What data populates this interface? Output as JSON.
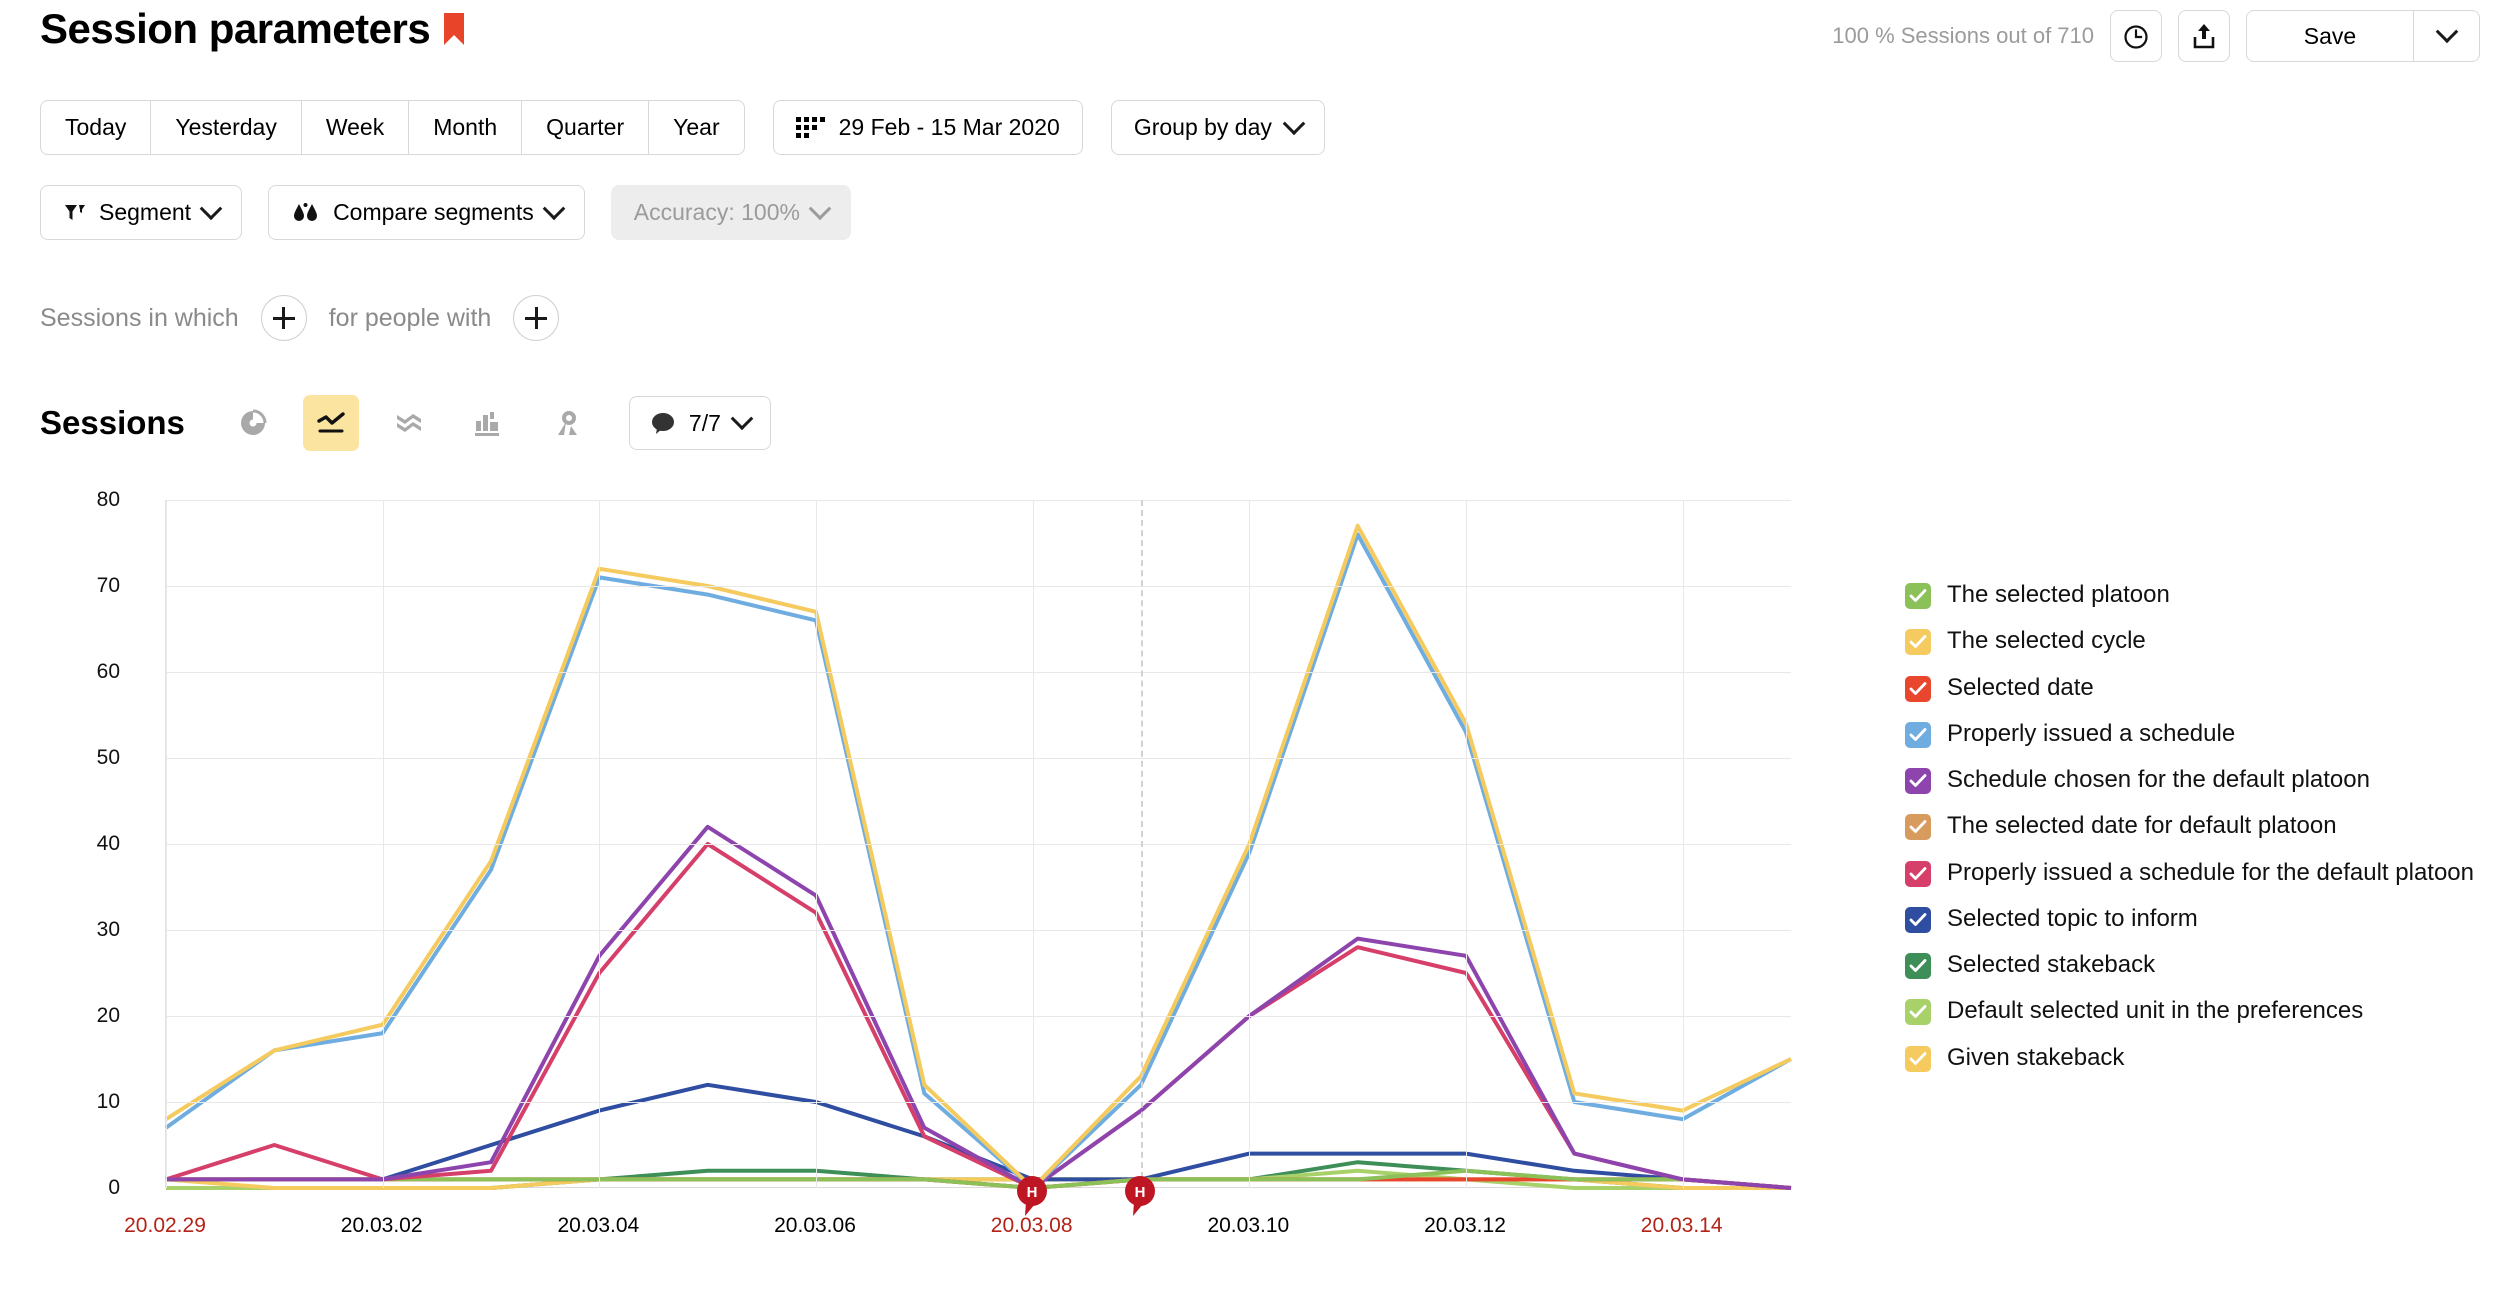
{
  "header": {
    "title": "Session parameters",
    "bookmark_icon": "bookmark-flag-icon",
    "bookmark_color": "#E8442A",
    "sessions_summary": "100 % Sessions out of 710",
    "history_icon": "clock-icon",
    "export_icon": "export-upload-icon",
    "save_label": "Save",
    "save_caret_icon": "chevron-down-icon"
  },
  "toolbar": {
    "periods": [
      "Today",
      "Yesterday",
      "Week",
      "Month",
      "Quarter",
      "Year"
    ],
    "date_range": "29 Feb - 15 Mar 2020",
    "calendar_icon": "calendar-grid-icon",
    "group_by": "Group by day",
    "segment_label": "Segment",
    "segment_icon": "funnel-icon",
    "compare_label": "Compare segments",
    "compare_icon": "two-drops-icon",
    "accuracy_label": "Accuracy: 100%",
    "accuracy_disabled": true
  },
  "filters": {
    "sessions_label": "Sessions in which",
    "people_label": "for people with",
    "add_icon": "plus-icon"
  },
  "chart_header": {
    "metric": "Sessions",
    "viz_buttons": [
      {
        "name": "pie-chart-icon",
        "active": false
      },
      {
        "name": "line-chart-icon",
        "active": true
      },
      {
        "name": "area-chart-icon",
        "active": false
      },
      {
        "name": "bar-chart-icon",
        "active": false
      },
      {
        "name": "map-pin-icon",
        "active": false
      }
    ],
    "annotations_count": "7/7",
    "annotations_icon": "speech-bubble-icon",
    "annotations_caret": "chevron-down-icon"
  },
  "chart_data": {
    "type": "line",
    "title": "Sessions",
    "xlabel": "",
    "ylabel": "",
    "ylim": [
      0,
      80
    ],
    "yticks": [
      0,
      10,
      20,
      30,
      40,
      50,
      60,
      70,
      80
    ],
    "grid": true,
    "legend_position": "right",
    "x": [
      "20.02.29",
      "20.03.01",
      "20.03.02",
      "20.03.03",
      "20.03.04",
      "20.03.05",
      "20.03.06",
      "20.03.07",
      "20.03.08",
      "20.03.09",
      "20.03.10",
      "20.03.11",
      "20.03.12",
      "20.03.13",
      "20.03.14",
      "20.03.15"
    ],
    "xtick_labels": [
      "20.02.29",
      "20.03.02",
      "20.03.04",
      "20.03.06",
      "20.03.08",
      "20.03.10",
      "20.03.12",
      "20.03.14"
    ],
    "weekend_xticks": [
      "20.02.29",
      "20.03.08",
      "20.03.14"
    ],
    "holiday_markers": [
      {
        "x": "20.03.08",
        "label": "H"
      },
      {
        "x": "20.03.09",
        "label": "H"
      }
    ],
    "series": [
      {
        "name": "The selected platoon",
        "color": "#8CC059",
        "values": [
          1,
          1,
          1,
          1,
          1,
          1,
          1,
          1,
          0,
          1,
          1,
          1,
          2,
          1,
          1,
          0
        ]
      },
      {
        "name": "The selected cycle",
        "color": "#F5CA5E",
        "values": [
          8,
          16,
          19,
          38,
          72,
          70,
          67,
          12,
          0,
          13,
          40,
          77,
          54,
          11,
          9,
          15
        ]
      },
      {
        "name": "Selected date",
        "color": "#E8472E",
        "values": [
          1,
          1,
          1,
          1,
          1,
          1,
          1,
          1,
          0,
          1,
          1,
          1,
          1,
          1,
          1,
          0
        ]
      },
      {
        "name": "Properly issued a schedule",
        "color": "#6FADE0",
        "values": [
          7,
          16,
          18,
          37,
          71,
          69,
          66,
          11,
          0,
          12,
          39,
          76,
          53,
          10,
          8,
          15
        ]
      },
      {
        "name": "Schedule chosen for the default platoon",
        "color": "#8E44AD",
        "values": [
          1,
          1,
          1,
          3,
          27,
          42,
          34,
          7,
          0,
          9,
          20,
          29,
          27,
          4,
          1,
          0
        ]
      },
      {
        "name": "The selected date for default platoon",
        "color": "#D89B5E",
        "values": [
          1,
          1,
          1,
          1,
          1,
          1,
          1,
          1,
          0,
          1,
          1,
          1,
          1,
          1,
          1,
          0
        ]
      },
      {
        "name": "Properly issued a schedule for the default platoon",
        "color": "#D53F6A",
        "values": [
          1,
          5,
          1,
          2,
          25,
          40,
          32,
          6,
          0,
          9,
          20,
          28,
          25,
          4,
          1,
          0
        ]
      },
      {
        "name": "Selected topic to inform",
        "color": "#2F4EA1",
        "values": [
          1,
          1,
          1,
          5,
          9,
          12,
          10,
          6,
          1,
          1,
          4,
          4,
          4,
          2,
          1,
          0
        ]
      },
      {
        "name": "Selected stakeback",
        "color": "#3E8E58",
        "values": [
          0,
          0,
          0,
          0,
          1,
          2,
          2,
          1,
          1,
          1,
          1,
          3,
          2,
          1,
          0,
          0
        ]
      },
      {
        "name": "Default selected unit in the preferences",
        "color": "#A8D16A",
        "values": [
          0,
          0,
          0,
          0,
          1,
          1,
          1,
          1,
          1,
          1,
          1,
          2,
          1,
          0,
          0,
          0
        ]
      },
      {
        "name": "Given stakeback",
        "color": "#F5CA5E",
        "values": [
          1,
          0,
          0,
          0,
          1,
          1,
          1,
          1,
          1,
          1,
          1,
          1,
          1,
          1,
          0,
          0
        ]
      }
    ]
  },
  "legend": {
    "items": [
      {
        "label": "The selected platoon",
        "color": "#8CC059"
      },
      {
        "label": "The selected cycle",
        "color": "#F5CA5E"
      },
      {
        "label": "Selected date",
        "color": "#E8472E"
      },
      {
        "label": "Properly issued a schedule",
        "color": "#6FADE0"
      },
      {
        "label": "Schedule chosen for the default platoon",
        "color": "#8E44AD"
      },
      {
        "label": "The selected date for default platoon",
        "color": "#D89B5E"
      },
      {
        "label": "Properly issued a schedule for the default platoon",
        "color": "#D53F6A"
      },
      {
        "label": "Selected topic to inform",
        "color": "#2F4EA1"
      },
      {
        "label": "Selected stakeback",
        "color": "#3E8E58"
      },
      {
        "label": "Default selected unit in the preferences",
        "color": "#A8D16A"
      },
      {
        "label": "Given stakeback",
        "color": "#F5CA5E"
      }
    ]
  }
}
